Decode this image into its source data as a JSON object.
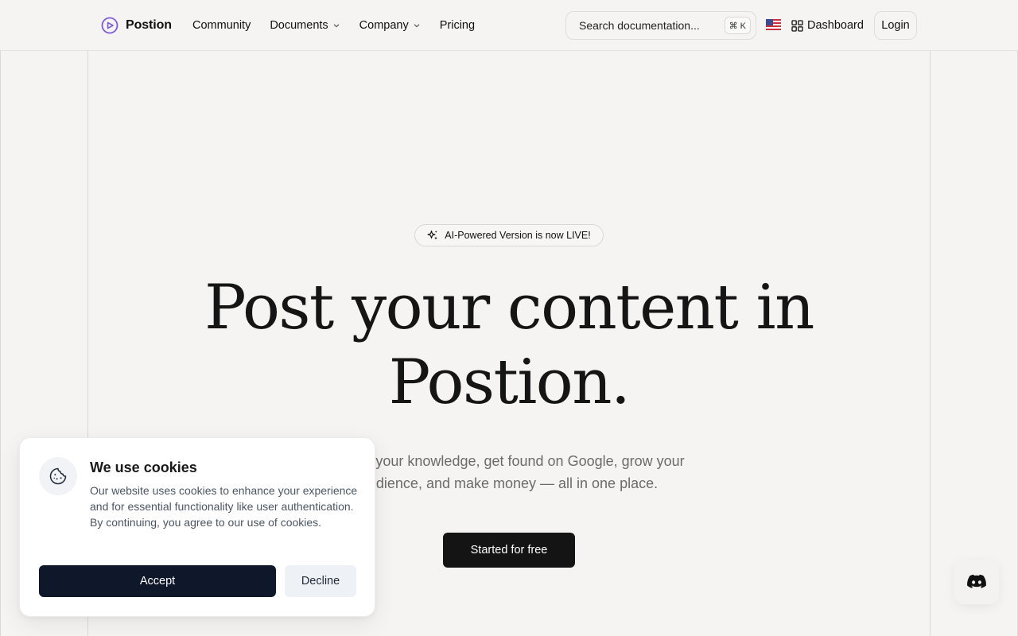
{
  "header": {
    "brand": {
      "name": "Postion",
      "icon": "play-circle-logo-icon",
      "color": "#7c5cd6"
    },
    "nav": [
      {
        "label": "Community",
        "has_dropdown": false
      },
      {
        "label": "Documents",
        "has_dropdown": true
      },
      {
        "label": "Company",
        "has_dropdown": true
      },
      {
        "label": "Pricing",
        "has_dropdown": false
      }
    ],
    "search": {
      "placeholder": "Search documentation...",
      "shortcut": "⌘ K"
    },
    "language_icon": "us-flag-icon",
    "dashboard_label": "Dashboard",
    "login_label": "Login"
  },
  "hero": {
    "badge": "AI-Powered Version is now LIVE!",
    "title_line1": "Post your content in",
    "title_line2": "Postion.",
    "subtitle_line1": "Share your knowledge, get found on Google, grow your",
    "subtitle_line2": "audience, and make money — all in one place.",
    "cta_label": "Started for free"
  },
  "cookie_banner": {
    "title": "We use cookies",
    "text": "Our website uses cookies to enhance your experience and for essential functionality like user authentication. By continuing, you agree to our use of cookies.",
    "accept_label": "Accept",
    "decline_label": "Decline",
    "icon": "cookie-icon"
  },
  "floating": {
    "discord_icon": "discord-icon"
  },
  "colors": {
    "background": "#f5f4f2",
    "primary_dark": "#141414",
    "accept_button": "#0f172a",
    "brand": "#7c5cd6"
  }
}
